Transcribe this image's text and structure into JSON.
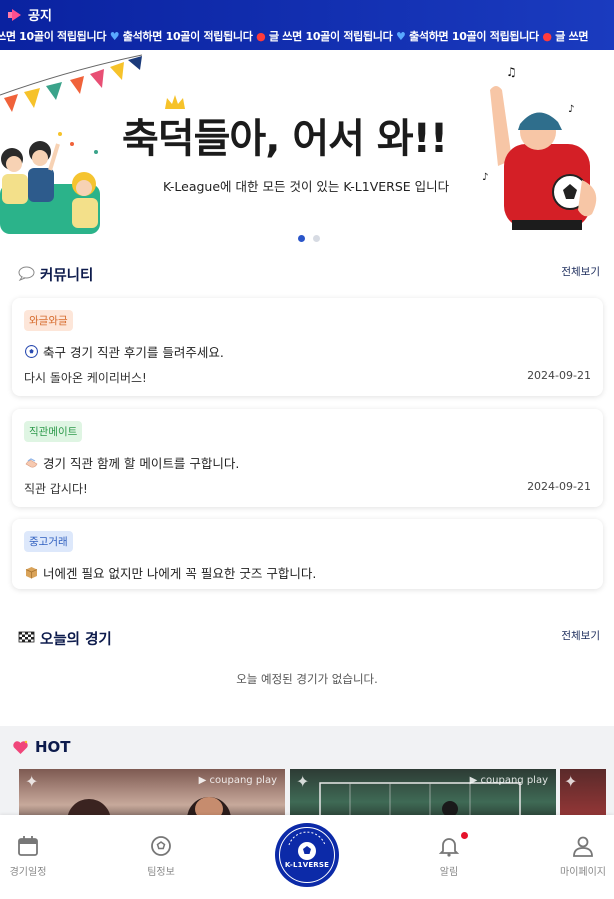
{
  "notice": {
    "title": "공지",
    "ticker": [
      {
        "text": "쓰면 10골이 적립됩니다",
        "icon": "heart-icon"
      },
      {
        "text": "출석하면 10골이 적립됩니다",
        "icon": "pin-icon"
      },
      {
        "text": "글 쓰면 10골이 적립됩니다",
        "icon": "heart-icon"
      },
      {
        "text": "출석하면 10골이 적립됩니다",
        "icon": "pin-icon"
      },
      {
        "text": "글 쓰면",
        "icon": ""
      }
    ]
  },
  "banner": {
    "title": "축덕들아, 어서 와!!",
    "subtitle": "K-League에 대한 모든 것이 있는 K-L1VERSE 입니다",
    "slides": 2,
    "active_slide": 0
  },
  "community": {
    "title": "커뮤니티",
    "more": "전체보기",
    "posts": [
      {
        "tag": "와글와글",
        "tag_color": "#d66a2b",
        "icon": "soccer-ball-icon",
        "title": "축구 경기 직관 후기를 들려주세요.",
        "body": "다시 돌아온 케이리버스!",
        "date": "2024-09-21"
      },
      {
        "tag": "직관메이트",
        "tag_color": "#2e9a4b",
        "icon": "handshake-icon",
        "title": "경기 직관 함께 할 메이트를 구합니다.",
        "body": "직관 갑시다!",
        "date": "2024-09-21"
      },
      {
        "tag": "중고거래",
        "tag_color": "#2f5fbf",
        "icon": "package-icon",
        "title": "너에겐 필요 없지만 나에게 꼭 필요한 굿즈 구합니다.",
        "body": "",
        "date": ""
      }
    ]
  },
  "today": {
    "title": "오늘의 경기",
    "more": "전체보기",
    "empty": "오늘 예정된 경기가 없습니다."
  },
  "hot": {
    "title": "HOT",
    "videos": [
      {
        "provider": "▶ coupang play"
      },
      {
        "provider": "▶ coupang play"
      },
      {
        "provider": ""
      }
    ]
  },
  "nav": {
    "items": [
      {
        "label": "경기일정",
        "icon": "calendar-icon"
      },
      {
        "label": "팀정보",
        "icon": "soccer-ball-icon"
      },
      {
        "label": "K-L1VERSE",
        "icon": "logo-icon"
      },
      {
        "label": "알림",
        "icon": "bell-icon"
      },
      {
        "label": "마이페이지",
        "icon": "user-icon"
      }
    ],
    "logo_text": "K-L1VERSE"
  },
  "colors": {
    "brand": "#0c2aa8",
    "active_dot": "#2a55c9",
    "notification": "#e5132b"
  }
}
